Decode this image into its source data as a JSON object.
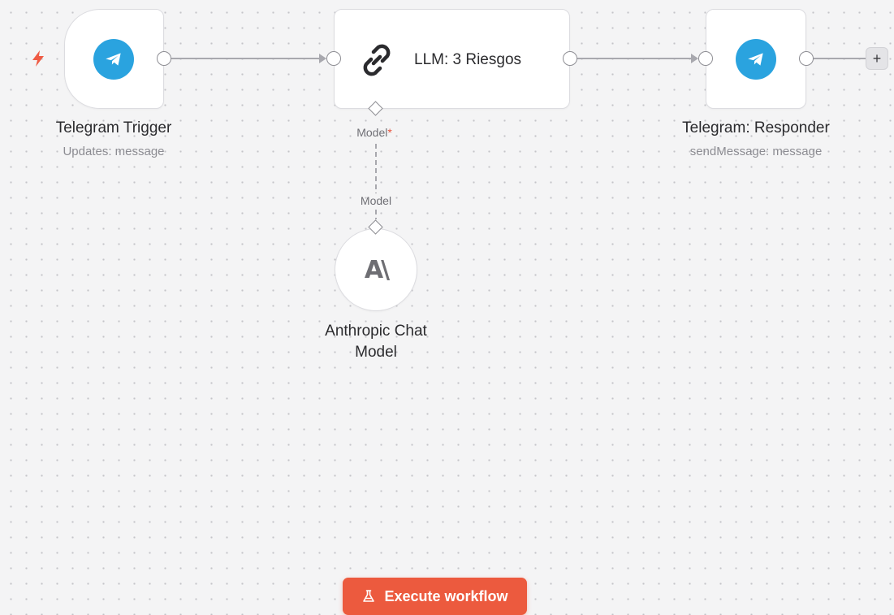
{
  "canvas": {
    "accent": "#ec5a3e",
    "telegram_color": "#2aa3df"
  },
  "nodes": {
    "telegram_trigger": {
      "name": "Telegram Trigger",
      "subtitle": "Updates: message",
      "icon": "telegram-icon"
    },
    "llm": {
      "name": "LLM: 3 Riesgos",
      "icon": "link-icon",
      "model_input_label": "Model",
      "required_marker": "*"
    },
    "telegram_responder": {
      "name": "Telegram: Responder",
      "subtitle": "sendMessage: message",
      "icon": "telegram-icon"
    },
    "anthropic": {
      "name_line1": "Anthropic Chat",
      "name_line2": "Model",
      "output_label": "Model",
      "logo_text": "A\\",
      "icon": "anthropic-logo"
    }
  },
  "toolbar": {
    "add_label": "+",
    "execute_label": "Execute workflow",
    "execute_icon": "flask-icon"
  }
}
